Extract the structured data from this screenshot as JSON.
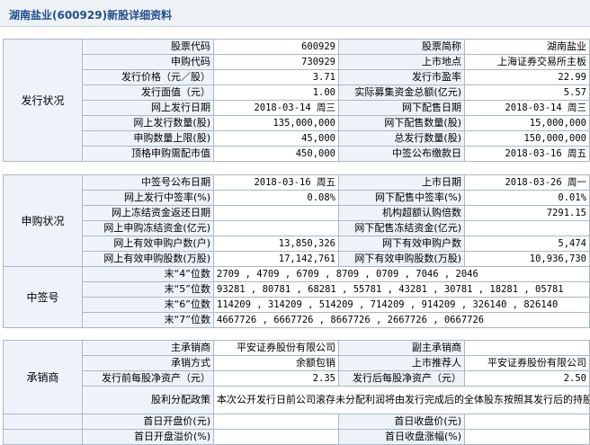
{
  "title": "湖南盐业(600929)新股详细资料",
  "sections": {
    "issue": "发行状况",
    "subscribe": "申购状况",
    "lottery": "中签号",
    "underwriter": "承销商"
  },
  "issue": {
    "r1": {
      "l1": "股票代码",
      "v1": "600929",
      "l2": "股票简称",
      "v2": "湖南盐业"
    },
    "r2": {
      "l1": "申购代码",
      "v1": "730929",
      "l2": "上市地点",
      "v2": "上海证券交易所主板"
    },
    "r3": {
      "l1": "发行价格（元／股）",
      "v1": "3.71",
      "l2": "发行市盈率",
      "v2": "22.99"
    },
    "r4": {
      "l1": "发行面值（元）",
      "v1": "1.00",
      "l2": "实际募集资金总额(亿元)",
      "v2": "5.57"
    },
    "r5": {
      "l1": "网上发行日期",
      "v1": "2018-03-14 周三",
      "l2": "网下配售日期",
      "v2": "2018-03-14 周三"
    },
    "r6": {
      "l1": "网上发行数量(股)",
      "v1": "135,000,000",
      "l2": "网下配售数量(股)",
      "v2": "15,000,000"
    },
    "r7": {
      "l1": "申购数量上限(股)",
      "v1": "45,000",
      "l2": "总发行数量(股)",
      "v2": "150,000,000"
    },
    "r8": {
      "l1": "顶格申购需配市值",
      "v1": "450,000",
      "l2": "中签公布缴款日",
      "v2": "2018-03-16 周五"
    }
  },
  "subscribe": {
    "r1": {
      "l1": "中签号公布日期",
      "v1": "2018-03-16 周五",
      "l2": "上市日期",
      "v2": "2018-03-26 周一"
    },
    "r2": {
      "l1": "网上发行中签率(%)",
      "v1": "0.08%",
      "l2": "网下配售中签率(%)",
      "v2": "0.01%"
    },
    "r3": {
      "l1": "网上冻结资金返还日期",
      "v1": "",
      "l2": "机构超额认购倍数",
      "v2": "7291.15"
    },
    "r4": {
      "l1": "网上申购冻结资金(亿元)",
      "v1": "",
      "l2": "网下配售冻结资金(亿元)",
      "v2": ""
    },
    "r5": {
      "l1": "网上有效申购户数(户)",
      "v1": "13,850,326",
      "l2": "网下有效申购户数",
      "v2": "5,474"
    },
    "r6": {
      "l1": "网上有效申购股数(万股)",
      "v1": "17,142,761",
      "l2": "网下有效申购股数(万股)",
      "v2": "10,936,730"
    }
  },
  "lottery": {
    "r1": {
      "l": "末“4”位数",
      "v": "2709 , 4709 , 6709 , 8709 , 0709 , 7046 , 2046"
    },
    "r2": {
      "l": "末“5”位数",
      "v": "93281 , 80781 , 68281 , 55781 , 43281 , 30781 , 18281 , 05781"
    },
    "r3": {
      "l": "末“6”位数",
      "v": "114209 , 314209 , 514209 , 714209 , 914209 , 326140 , 826140"
    },
    "r4": {
      "l": "末“7”位数",
      "v": "4667726 , 6667726 , 8667726 , 2667726 , 0667726"
    }
  },
  "underwriter": {
    "r1": {
      "l1": "主承销商",
      "v1": "平安证券股份有限公司",
      "l2": "副主承销商",
      "v2": ""
    },
    "r2": {
      "l1": "承销方式",
      "v1": "余额包销",
      "l2": "上市推荐人",
      "v2": "平安证券股份有限公司"
    },
    "r3": {
      "l1": "发行前每股净资产（元）",
      "v1": "2.35",
      "l2": "发行后每股净资产（元）",
      "v2": "2.50"
    },
    "r4": {
      "l": "股利分配政策",
      "v": "本次公开发行日前公司滚存未分配利润将由发行完成后的全体股东按照其发行后的持股比例共同享有。"
    },
    "r5": {
      "l1": "首日开盘价(元)",
      "v1": "",
      "l2": "首日收盘价(元)",
      "v2": ""
    },
    "r6": {
      "l1": "首日开盘溢价(%)",
      "v1": "",
      "l2": "首日收盘涨幅(%)",
      "v2": ""
    }
  }
}
